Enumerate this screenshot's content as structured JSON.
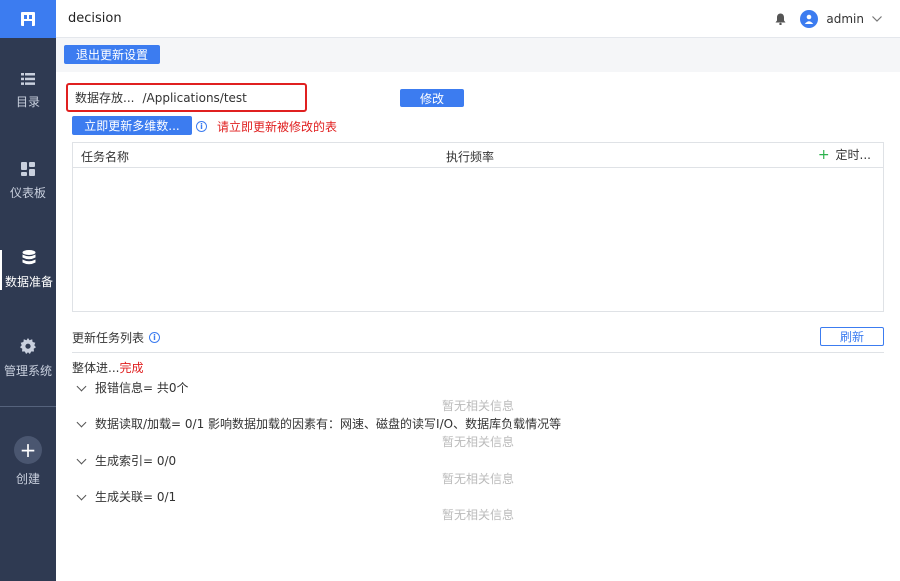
{
  "app": {
    "title": "decision"
  },
  "user": {
    "name": "admin"
  },
  "sidebar": {
    "items": [
      {
        "label": "目录",
        "icon": "list-icon"
      },
      {
        "label": "仪表板",
        "icon": "dashboard-icon"
      },
      {
        "label": "数据准备",
        "icon": "database-icon",
        "active": true
      },
      {
        "label": "管理系统",
        "icon": "gear-icon"
      }
    ],
    "create_label": "创建"
  },
  "toolbar": {
    "exit_label": "退出更新设置"
  },
  "storage": {
    "label": "数据存放...",
    "path": "/Applications/test",
    "modify_label": "修改"
  },
  "update_now": {
    "label": "立即更新多维数...",
    "hint": "请立即更新被修改的表"
  },
  "task_table": {
    "columns": [
      "任务名称",
      "执行频率",
      "定时..."
    ]
  },
  "update_list": {
    "title": "更新任务列表",
    "refresh_label": "刷新",
    "progress_label": "整体进...",
    "progress_status": "完成",
    "groups": [
      {
        "label": "报错信息= 共0个",
        "empty": "暂无相关信息"
      },
      {
        "label": "数据读取/加载= 0/1 影响数据加载的因素有：网速、磁盘的读写I/O、数据库负载情况等",
        "empty": "暂无相关信息"
      },
      {
        "label": "生成索引= 0/0",
        "empty": "暂无相关信息"
      },
      {
        "label": "生成关联= 0/1",
        "empty": "暂无相关信息"
      }
    ]
  },
  "colors": {
    "primary": "#3c7cf0",
    "sidebar": "#2f3a52",
    "danger": "#e02020",
    "add": "#2bb24c"
  }
}
